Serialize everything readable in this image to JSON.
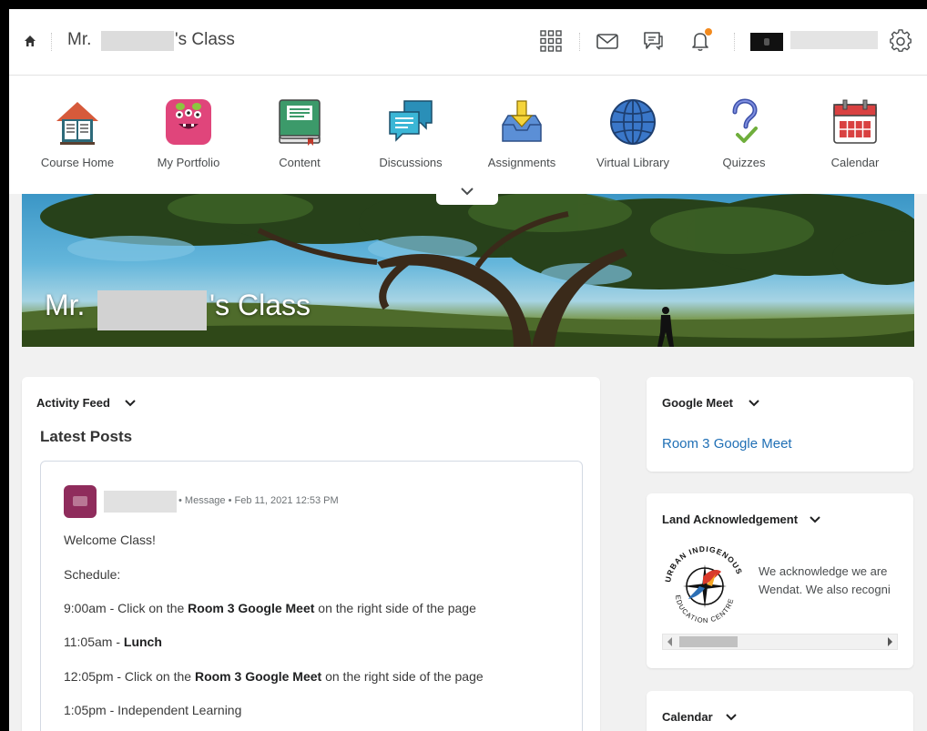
{
  "topbar": {
    "class_prefix": "Mr.",
    "class_suffix": "'s Class"
  },
  "nav": {
    "items": [
      {
        "label": "Course Home"
      },
      {
        "label": "My Portfolio"
      },
      {
        "label": "Content"
      },
      {
        "label": "Discussions"
      },
      {
        "label": "Assignments"
      },
      {
        "label": "Virtual Library"
      },
      {
        "label": "Quizzes"
      },
      {
        "label": "Calendar"
      }
    ]
  },
  "banner": {
    "prefix": "Mr.",
    "suffix": "'s Class"
  },
  "activity_feed": {
    "widget_title": "Activity Feed",
    "heading": "Latest Posts",
    "post": {
      "meta": "• Message • Feb 11, 2021 12:53 PM",
      "greeting": "Welcome Class!",
      "schedule_label": "Schedule:",
      "lines": [
        {
          "time": "9:00am - Click on the ",
          "bold": "Room 3 Google Meet",
          "rest": " on the right side of the page"
        },
        {
          "time": "11:05am - ",
          "bold": "Lunch",
          "rest": ""
        },
        {
          "time": "12:05pm - Click on the ",
          "bold": "Room 3 Google Meet",
          "rest": " on the right side of the page"
        },
        {
          "time": "1:05pm - Independent Learning",
          "bold": "",
          "rest": ""
        }
      ]
    }
  },
  "google_meet": {
    "widget_title": "Google Meet",
    "link": "Room 3 Google Meet"
  },
  "land": {
    "widget_title": "Land Acknowledgement",
    "logo_top": "URBAN INDIGENOUS",
    "logo_bottom": "EDUCATION CENTRE",
    "line1": "We acknowledge we are",
    "line2": "Wendat. We also recogni"
  },
  "calendar": {
    "widget_title": "Calendar"
  },
  "colors": {
    "link": "#1f6fb5",
    "notification": "#f28a1e",
    "post_avatar": "#8f2c5c"
  }
}
